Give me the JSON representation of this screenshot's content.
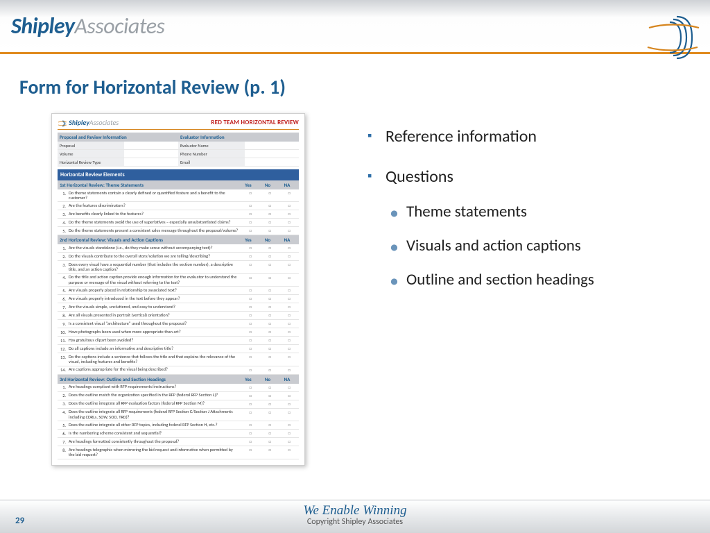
{
  "brand": {
    "part1": "Shipley",
    "part2": "Associates"
  },
  "slide_title": "Form for Horizontal Review (p. 1)",
  "page_number": "29",
  "footer": {
    "tagline": "We Enable Winning",
    "copyright": "Copyright Shipley Associates"
  },
  "bullets": {
    "b1": "Reference information",
    "b2": "Questions",
    "sub1": "Theme statements",
    "sub2": "Visuals and action captions",
    "sub3": "Outline and section headings"
  },
  "form": {
    "brand1": "Shipley",
    "brand2": "Associates",
    "title": "RED TEAM HORIZONTAL REVIEW",
    "info_left_head": "Proposal and Review Information",
    "info_right_head": "Evaluator Information",
    "info_left": [
      "Proposal",
      "Volume",
      "Horizontal Review Type"
    ],
    "info_right": [
      "Evaluator Name",
      "Phone Number",
      "Email"
    ],
    "elements_bar": "Horizontal Review Elements",
    "col_yes": "Yes",
    "col_no": "No",
    "col_na": "NA",
    "sec1": {
      "title": "1st Horizontal Review:  Theme Statements",
      "q": [
        "Do theme statements contain a clearly defined or quantified feature and a benefit to the customer?",
        "Are the features discriminators?",
        "Are benefits clearly linked to the features?",
        "Do the theme statements avoid the use of superlatives – especially unsubstantiated claims?",
        "Do the theme statements present a consistent sales message throughout the proposal/volume?"
      ]
    },
    "sec2": {
      "title": "2nd Horizontal Review:  Visuals and Action Captions",
      "q": [
        "Are the visuals standalone (i.e., do they make sense without accompanying text)?",
        "Do the visuals contribute to the overall story/solution we are telling/describing?",
        "Does every visual have a sequential number (that includes the section number), a descriptive title, and an action caption?",
        "Do the title and action caption provide enough information for the evaluator to understand the purpose or message of the visual without referring to the text?",
        "Are visuals properly placed in relationship to associated text?",
        "Are visuals properly introduced in the text before they appear?",
        "Are the visuals simple, uncluttered, and easy to understand?",
        "Are all visuals presented in portrait (vertical) orientation?",
        "Is a consistent visual \"architecture\" used throughout the proposal?",
        "Have photographs been used when more appropriate than art?",
        "Has gratuitous clipart been avoided?",
        "Do all captions include an informative and descriptive title?",
        "Do the captions include a sentence that follows the title and that explains the relevance of the visual, including features and benefits?",
        "Are captions appropriate for the visual being described?"
      ]
    },
    "sec3": {
      "title": "3rd Horizontal Review:  Outline and Section Headings",
      "q": [
        "Are headings compliant with RFP requirements/instructions?",
        "Does the outline match the organization specified in the RFP (federal RFP Section L)?",
        "Does the outline integrate all RFP evaluation factors (federal RFP Section M)?",
        "Does the outline integrate all RFP requirements (federal RFP Section C/Section J Attachments including CDRLs, SOW, SOO, TRD)?",
        "Does the outline integrate all other RFP topics, including federal RFP Section H, etc.?",
        "Is the numbering scheme consistent and sequential?",
        "Are headings formatted consistently throughout the proposal?",
        "Are headings telegraphic when mirroring the bid request and informative when permitted by the bid request?"
      ]
    }
  }
}
